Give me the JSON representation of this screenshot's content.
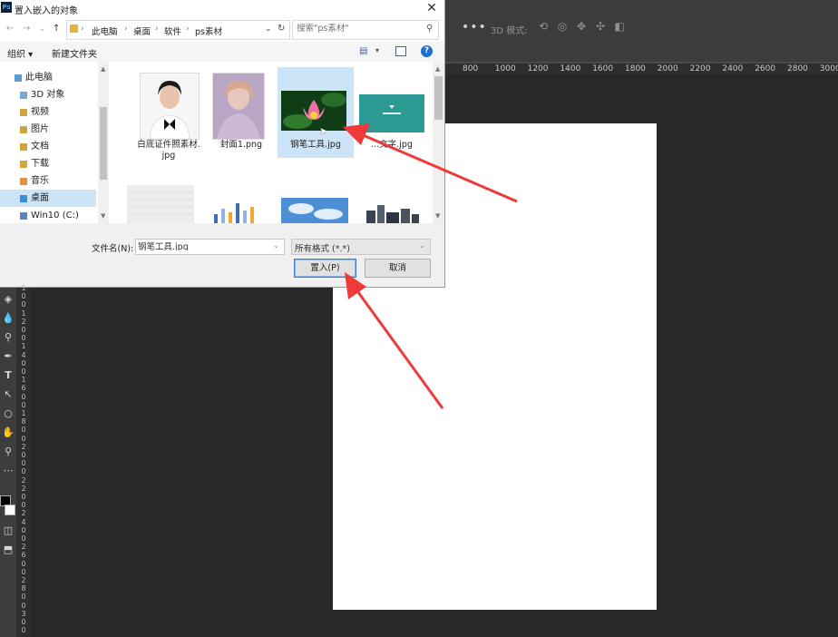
{
  "photoshop": {
    "options_bar": {
      "more_glyph": "•••",
      "mode_label": "3D 模式:"
    },
    "ruler_labels": [
      "800",
      "1000",
      "1200",
      "1400",
      "1600",
      "1800",
      "2000",
      "2200",
      "2400",
      "2600",
      "2800",
      "3000"
    ],
    "vertical_ruler_digits": [
      "1",
      "0",
      "0",
      "1",
      "2",
      "0",
      "0",
      "1",
      "4",
      "0",
      "0",
      "1",
      "6",
      "0",
      "0",
      "1",
      "8",
      "0",
      "0",
      "2",
      "0",
      "0",
      "0",
      "2",
      "2",
      "0",
      "0",
      "2",
      "4",
      "0",
      "0",
      "2",
      "6",
      "0",
      "0",
      "2",
      "8",
      "0",
      "0",
      "3",
      "0",
      "0"
    ],
    "canvas_color": "#ffffff",
    "background_color": "#282828"
  },
  "dialog": {
    "app_icon": "Ps",
    "title": "置入嵌入的对象",
    "close_glyph": "✕",
    "address": {
      "breadcrumbs": [
        "此电脑",
        "桌面",
        "软件",
        "ps素材"
      ],
      "separator": "›"
    },
    "search": {
      "placeholder": "搜索\"ps素材\""
    },
    "toolbar": {
      "organize": "组织 ▾",
      "new_folder": "新建文件夹",
      "help_glyph": "?"
    },
    "nav": {
      "items": [
        {
          "label": "此电脑"
        },
        {
          "label": "3D 对象"
        },
        {
          "label": "视频"
        },
        {
          "label": "图片"
        },
        {
          "label": "文档"
        },
        {
          "label": "下载"
        },
        {
          "label": "音乐"
        },
        {
          "label": "桌面",
          "selected": true
        },
        {
          "label": "Win10 (C:)"
        }
      ]
    },
    "files": [
      {
        "name": "白底证件照素材.\njpg",
        "thumb": "portrait"
      },
      {
        "name": "封面1.png",
        "thumb": "painting"
      },
      {
        "name": "钢笔工具.jpg",
        "thumb": "lotus",
        "selected": true
      },
      {
        "name": "...文字.jpg",
        "thumb": "teal-banner"
      }
    ],
    "filename": {
      "label": "文件名(N):",
      "value": "钢笔工具.jpg"
    },
    "filter": {
      "value": "所有格式 (*.*)"
    },
    "buttons": {
      "place": "置入(P)",
      "cancel": "取消"
    },
    "accent_color": "#3b7bd1"
  },
  "annotation": {
    "arrow_color": "#f03a3a"
  }
}
